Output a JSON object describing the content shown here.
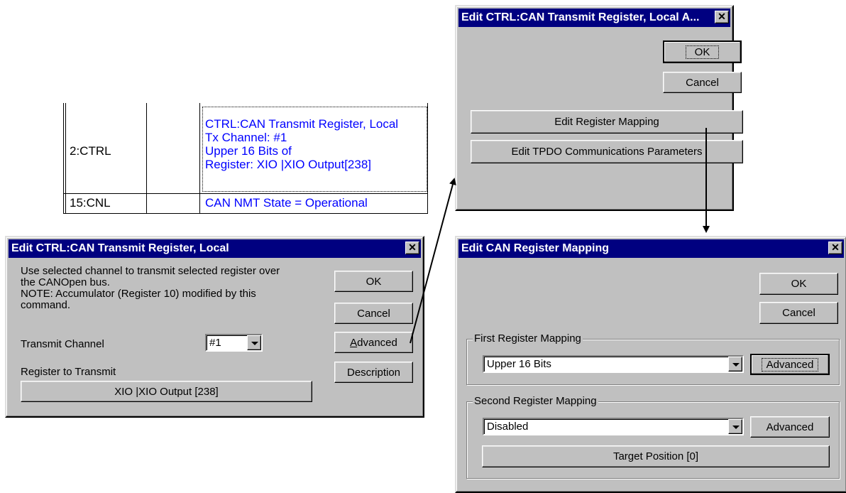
{
  "program_table": {
    "row1": {
      "label": "2:CTRL",
      "comment_lines": [
        "CTRL:CAN Transmit Register, Local",
        "Tx Channel:  #1",
        "Upper 16 Bits of",
        "Register:  XIO |XIO Output[238]"
      ]
    },
    "row2": {
      "label": "15:CNL",
      "comment": "CAN NMT State = Operational"
    }
  },
  "dialog_local": {
    "title": "Edit CTRL:CAN Transmit Register, Local",
    "description": [
      "Use selected channel to transmit selected register over",
      "the CANOpen bus.",
      "NOTE:  Accumulator (Register 10) modified by this",
      "command."
    ],
    "transmit_channel_label": "Transmit Channel",
    "transmit_channel_value": "#1",
    "register_label": "Register to Transmit",
    "register_value": "XIO |XIO Output [238]",
    "ok_label": "OK",
    "cancel_label": "Cancel",
    "advanced_label_first": "A",
    "advanced_label_rest": "dvanced",
    "description_label": "Description"
  },
  "dialog_advanced": {
    "title": "Edit CTRL:CAN Transmit Register, Local A...",
    "ok_label": "OK",
    "cancel_label": "Cancel",
    "edit_mapping_label": "Edit Register Mapping",
    "edit_tpdo_label": "Edit TPDO Communications Parameters"
  },
  "dialog_mapping": {
    "title": "Edit CAN Register Mapping",
    "ok_label": "OK",
    "cancel_label": "Cancel",
    "first_group_title": "First Register Mapping",
    "first_value": "Upper 16 Bits",
    "first_advanced_label": "Advanced",
    "second_group_title": "Second Register Mapping",
    "second_value": "Disabled",
    "second_advanced_label": "Advanced",
    "target_position_label": "Target Position [0]"
  },
  "icons": {
    "close": "close-icon",
    "dropdown": "chevron-down-icon"
  },
  "colors": {
    "title_bar": "#000080",
    "dialog_face": "#c0c0c0",
    "comment_text": "#0000ff"
  }
}
